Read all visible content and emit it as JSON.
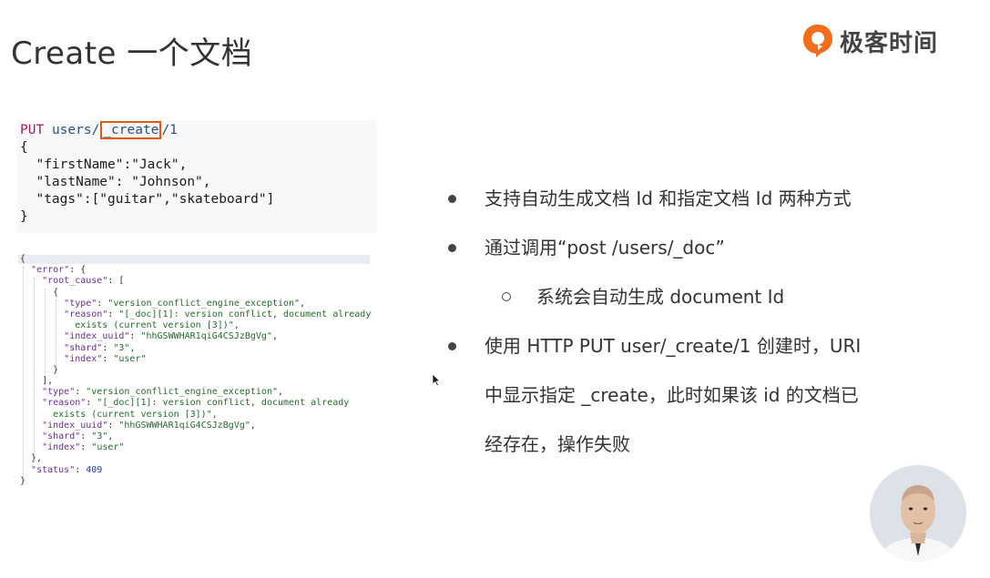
{
  "slide": {
    "title": "Create 一个文档"
  },
  "logo": {
    "text": "极客时间",
    "icon": "geektime-logo-icon",
    "color": "#f26d1c"
  },
  "request": {
    "method": "PUT",
    "path_prefix": "users/",
    "path_highlight": "_create",
    "path_suffix": "/1",
    "body_lines": [
      "{",
      "  \"firstName\":\"Jack\",",
      "  \"lastName\": \"Johnson\",",
      "  \"tags\":[\"guitar\",\"skateboard\"]",
      "}"
    ],
    "highlight_color": "#e05a10"
  },
  "response": {
    "lines": [
      "{",
      "  \"error\": {",
      "    \"root_cause\": [",
      "      {",
      "        \"type\": \"version_conflict_engine_exception\",",
      "        \"reason\": \"[_doc][1]: version conflict, document already",
      "          exists (current version [3])\",",
      "        \"index_uuid\": \"hhGSWWHAR1qiG4CSJzBgVg\",",
      "        \"shard\": \"3\",",
      "        \"index\": \"user\"",
      "      }",
      "    ],",
      "    \"type\": \"version_conflict_engine_exception\",",
      "    \"reason\": \"[_doc][1]: version conflict, document already",
      "      exists (current version [3])\",",
      "    \"index_uuid\": \"hhGSWWHAR1qiG4CSJzBgVg\",",
      "    \"shard\": \"3\",",
      "    \"index\": \"user\"",
      "  },",
      "  \"status\": 409",
      "}"
    ]
  },
  "bullets": [
    {
      "level": 1,
      "text": "支持自动生成文档 Id 和指定文档 Id 两种方式"
    },
    {
      "level": 1,
      "text": "通过调用“post /users/_doc”"
    },
    {
      "level": 2,
      "text": "系统会自动生成 document Id"
    },
    {
      "level": 1,
      "text": "使用 HTTP PUT  user/_create/1 创建时，URI"
    },
    {
      "level": 0,
      "text": "中显示指定 _create，此时如果该 id 的文档已"
    },
    {
      "level": 0,
      "text": "经存在，操作失败"
    }
  ],
  "presenter": {
    "icon": "presenter-avatar"
  }
}
